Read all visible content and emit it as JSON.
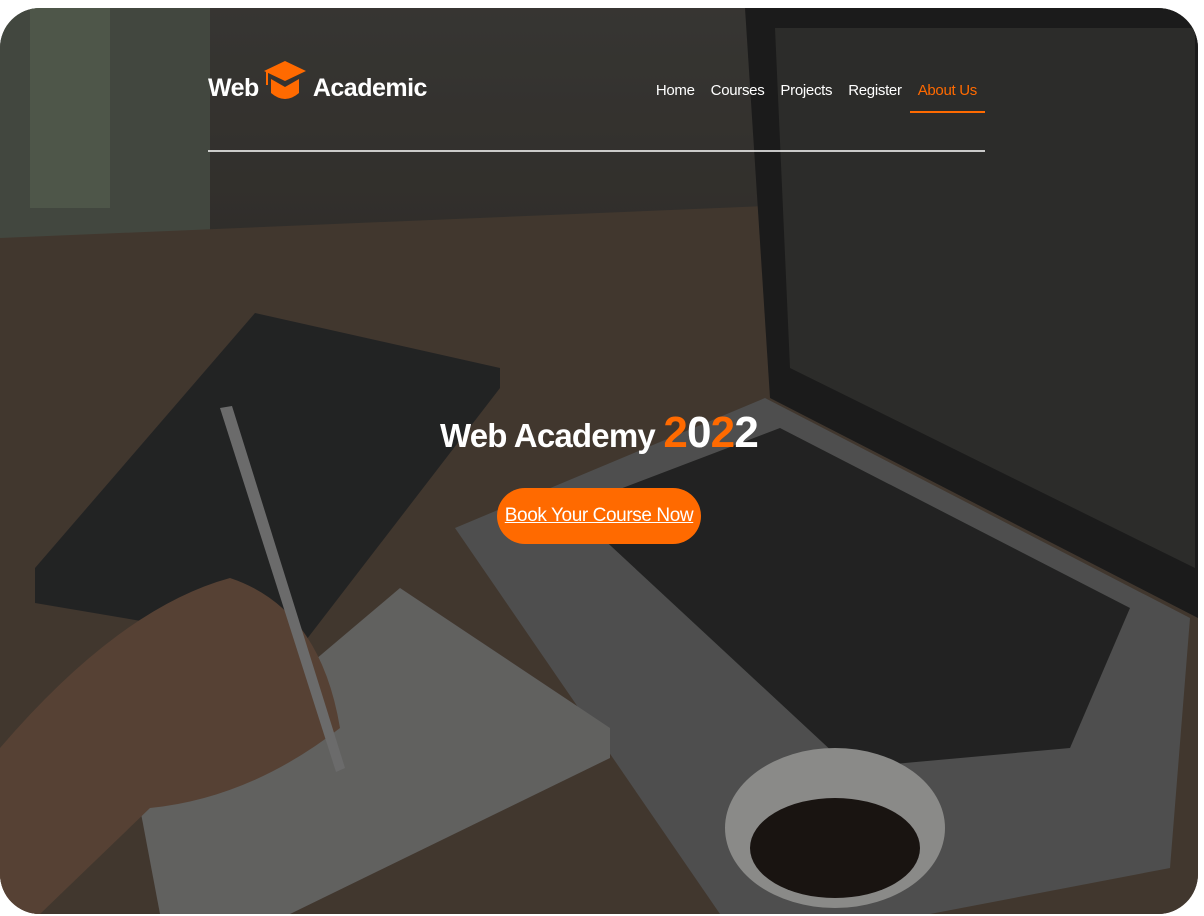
{
  "header": {
    "logo_left": "Web",
    "logo_right": "Academic",
    "nav": [
      "Home",
      "Courses",
      "Projects",
      "Register",
      "About Us"
    ],
    "active_nav": "About Us"
  },
  "hero": {
    "title_prefix": "Web Academy",
    "year_digits": [
      "2",
      "0",
      "2",
      "2"
    ],
    "cta_label": "Book Your Course Now"
  },
  "colors": {
    "accent": "#ff6a00",
    "text": "#ffffff"
  },
  "icons": [
    "graduation-cap-icon"
  ]
}
